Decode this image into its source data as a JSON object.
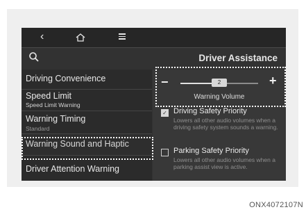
{
  "header": {
    "back_glyph": "‹",
    "home_icon": "home-icon",
    "menu_icon": "menu-icon",
    "search_icon": "search-icon",
    "title": "Driver Assistance"
  },
  "sidebar": {
    "items": [
      {
        "label": "Driving Convenience",
        "sub": ""
      },
      {
        "label": "Speed Limit",
        "sub": "Speed Limit Warning"
      },
      {
        "label": "Warning Timing",
        "sub": "Standard"
      },
      {
        "label": "Warning Sound and Haptic",
        "sub": ""
      },
      {
        "label": "Driver Attention Warning",
        "sub": ""
      }
    ]
  },
  "volume": {
    "minus_label": "−",
    "plus_label": "+",
    "value": "2",
    "level_fraction": 0.5,
    "label": "Warning Volume"
  },
  "options": [
    {
      "checked": true,
      "check_glyph": "✓",
      "title": "Driving Safety Priority",
      "description": "Lowers all other audio volumes when a driving safety system sounds a warning."
    },
    {
      "checked": false,
      "check_glyph": "",
      "title": "Parking Safety Priority",
      "description": "Lowers all other audio volumes when a parking assist view is active."
    }
  ],
  "figure_code": "ONX4072107N",
  "colors": {
    "screen_bg": "#323232",
    "sidebar_bg": "#2b2b2b",
    "text": "#e8e8e8",
    "callout": "#ffffff"
  }
}
